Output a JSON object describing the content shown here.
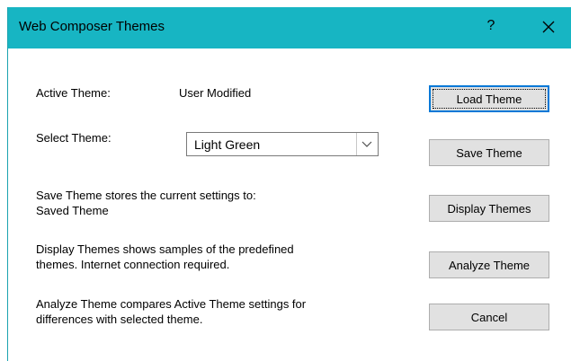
{
  "window": {
    "title": "Web Composer Themes",
    "help_label": "?"
  },
  "active_theme": {
    "label": "Active Theme:",
    "value": "User Modified"
  },
  "select_theme": {
    "label": "Select Theme:",
    "value": "Light Green"
  },
  "descriptions": {
    "save_line1": "Save Theme stores the current settings to:",
    "save_line2": "Saved Theme",
    "display_line1": "Display Themes shows samples of the predefined",
    "display_line2": "themes. Internet connection required.",
    "analyze_line1": "Analyze Theme compares Active Theme settings for",
    "analyze_line2": "differences with selected theme."
  },
  "buttons": {
    "load": "Load Theme",
    "save": "Save Theme",
    "display": "Display Themes",
    "analyze": "Analyze Theme",
    "cancel": "Cancel"
  },
  "colors": {
    "titlebar": "#17b5c3",
    "focus_border": "#0078d7"
  }
}
